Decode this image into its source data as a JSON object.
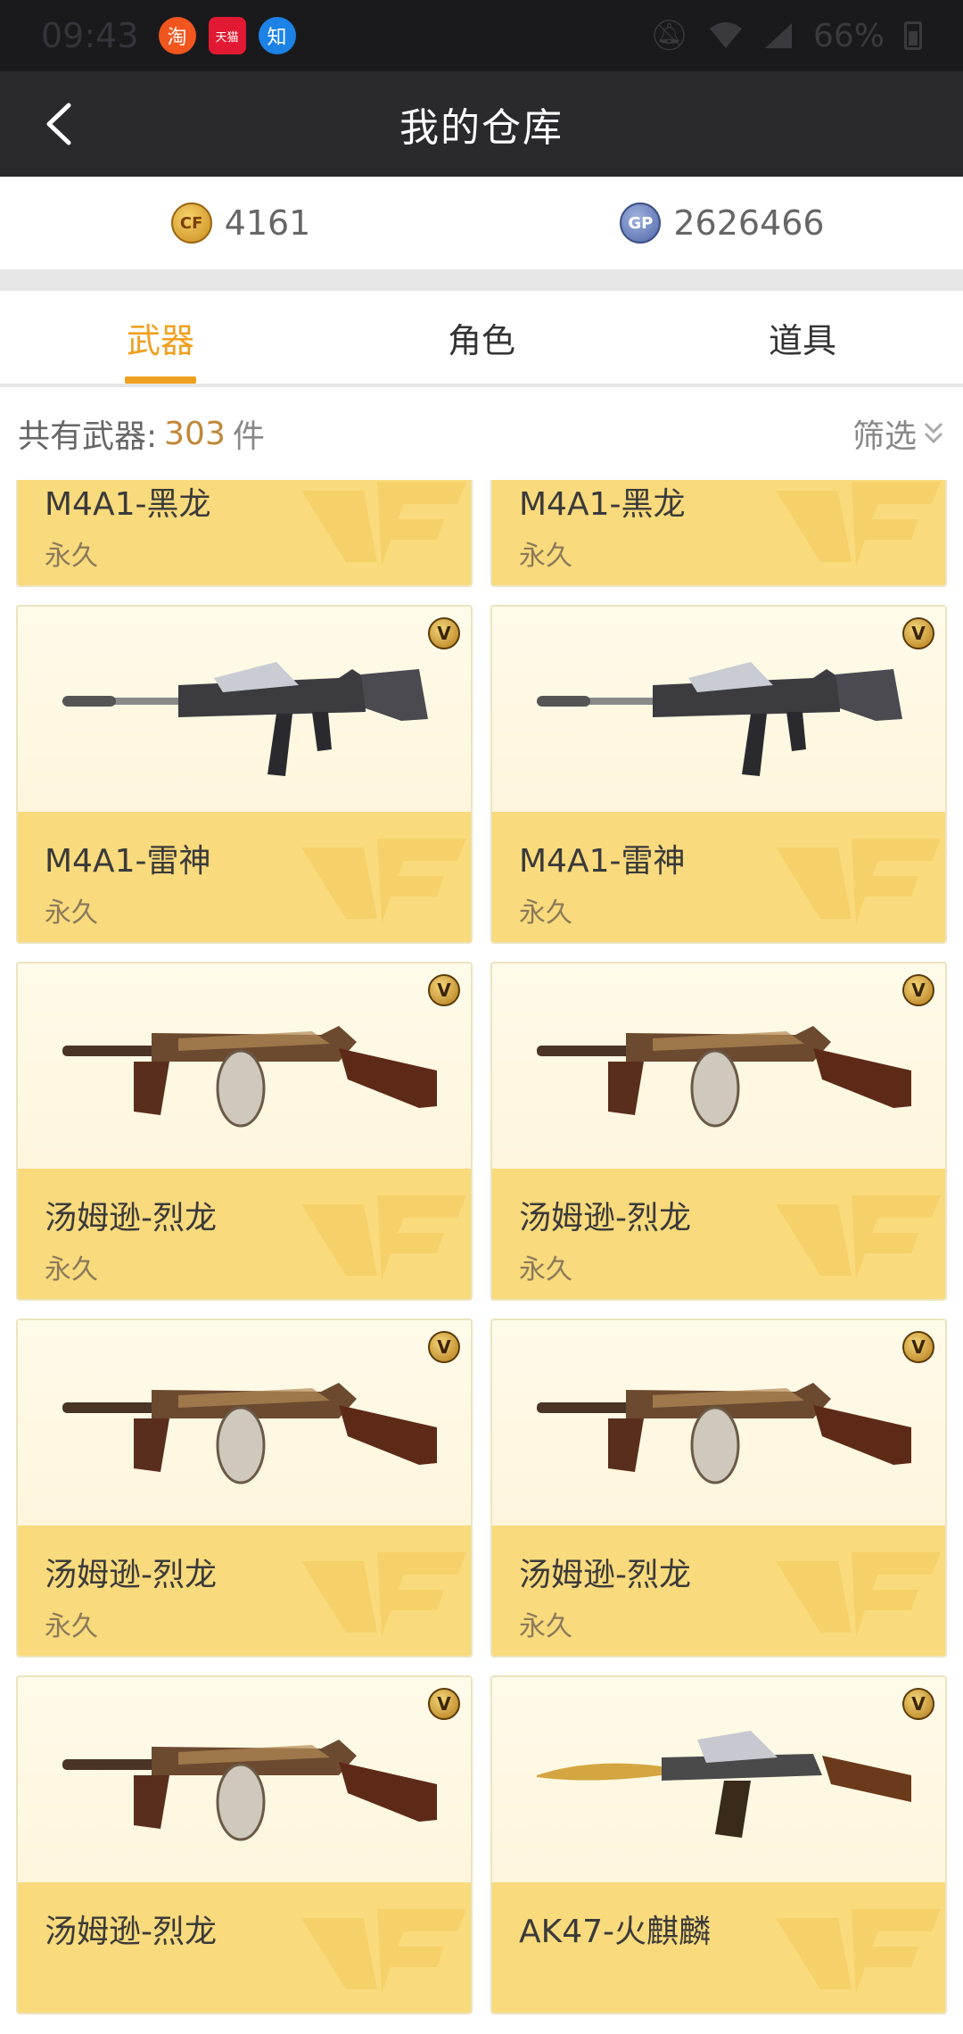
{
  "status_bar": {
    "time": "09:43",
    "battery": "66%",
    "app_icons": [
      {
        "name": "taobao-icon",
        "glyph": "淘"
      },
      {
        "name": "tmall-icon",
        "glyph": "天猫"
      },
      {
        "name": "zhihu-icon",
        "glyph": "知"
      }
    ]
  },
  "header": {
    "title": "我的仓库"
  },
  "currency": {
    "cf_points": "4161",
    "gp_points": "2626466",
    "cf_icon_label": "CF",
    "gp_icon_label": "GP"
  },
  "tabs": [
    {
      "label": "武器",
      "active": true
    },
    {
      "label": "角色",
      "active": false
    },
    {
      "label": "道具",
      "active": false
    }
  ],
  "summary": {
    "label": "共有武器:",
    "count": "303",
    "unit": "件",
    "filter_label": "筛选"
  },
  "colors": {
    "accent": "#f0a020",
    "card_info_bg": "#f9da7c",
    "card_image_bg": "#fef9e3",
    "nav_bg": "#2a2a2d"
  },
  "items": [
    {
      "name": "M4A1-黑龙",
      "duration": "永久",
      "weapon_icon": "rifle-icon"
    },
    {
      "name": "M4A1-黑龙",
      "duration": "永久",
      "weapon_icon": "rifle-icon"
    },
    {
      "name": "M4A1-雷神",
      "duration": "永久",
      "weapon_icon": "rifle-icon"
    },
    {
      "name": "M4A1-雷神",
      "duration": "永久",
      "weapon_icon": "rifle-icon"
    },
    {
      "name": "汤姆逊-烈龙",
      "duration": "永久",
      "weapon_icon": "smg-icon"
    },
    {
      "name": "汤姆逊-烈龙",
      "duration": "永久",
      "weapon_icon": "smg-icon"
    },
    {
      "name": "汤姆逊-烈龙",
      "duration": "永久",
      "weapon_icon": "smg-icon"
    },
    {
      "name": "汤姆逊-烈龙",
      "duration": "永久",
      "weapon_icon": "smg-icon"
    },
    {
      "name": "汤姆逊-烈龙",
      "duration": "",
      "weapon_icon": "smg-icon"
    },
    {
      "name": "AK47-火麒麟",
      "duration": "",
      "weapon_icon": "ak-icon"
    }
  ]
}
